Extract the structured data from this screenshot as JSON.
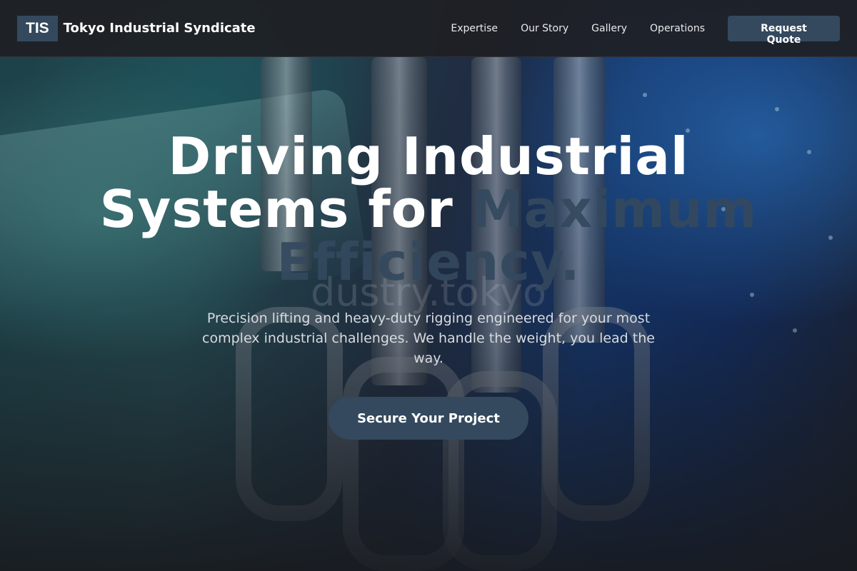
{
  "navbar": {
    "logo_text": "TIS",
    "brand_name": "Tokyo Industrial Syndicate",
    "links": [
      "Expertise",
      "Our Story",
      "Gallery",
      "Operations"
    ],
    "quote_label": "Request Quote"
  },
  "hero": {
    "headline_main": "Driving Industrial Systems for ",
    "headline_accent": "Maximum Efficiency.",
    "ghost_text": "dustry.tokyo",
    "subtext": "Precision lifting and heavy-duty rigging engineered for your most complex industrial challenges. We handle the weight, you lead the way.",
    "cta_label": "Secure Your Project"
  },
  "colors": {
    "accent": "#34495e",
    "navbar_bg": "#1e2024",
    "text_light": "#ffffff"
  },
  "icons": {
    "background": "rigging-shackle-photo"
  }
}
